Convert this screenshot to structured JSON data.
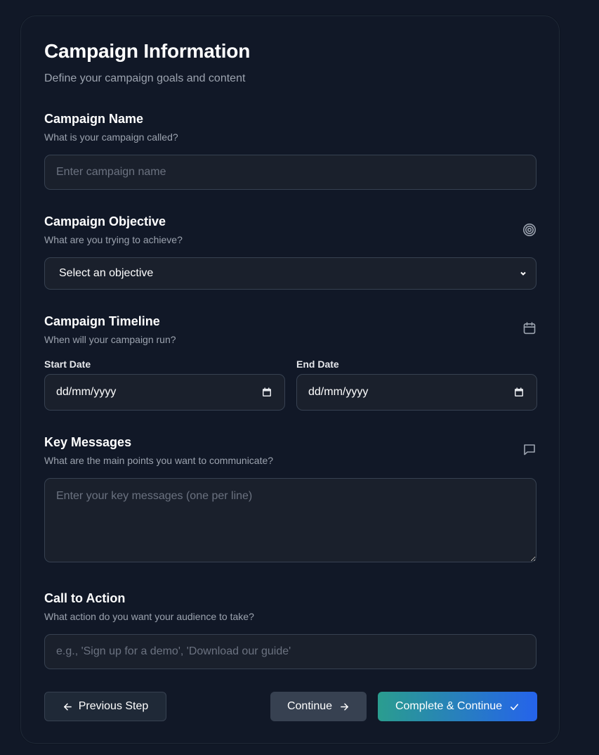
{
  "header": {
    "title": "Campaign Information",
    "subtitle": "Define your campaign goals and content"
  },
  "campaign_name": {
    "title": "Campaign Name",
    "description": "What is your campaign called?",
    "placeholder": "Enter campaign name",
    "value": ""
  },
  "objective": {
    "title": "Campaign Objective",
    "description": "What are you trying to achieve?",
    "icon": "target-icon",
    "selected": "Select an objective"
  },
  "timeline": {
    "title": "Campaign Timeline",
    "description": "When will your campaign run?",
    "icon": "calendar-icon",
    "start_label": "Start Date",
    "start_value": "dd/mm/yyyy",
    "end_label": "End Date",
    "end_value": "dd/mm/yyyy"
  },
  "key_messages": {
    "title": "Key Messages",
    "description": "What are the main points you want to communicate?",
    "icon": "message-icon",
    "placeholder": "Enter your key messages (one per line)",
    "value": ""
  },
  "call_to_action": {
    "title": "Call to Action",
    "description": "What action do you want your audience to take?",
    "placeholder": "e.g., 'Sign up for a demo', 'Download our guide'",
    "value": ""
  },
  "buttons": {
    "previous": "Previous Step",
    "continue": "Continue",
    "complete": "Complete & Continue"
  },
  "colors": {
    "background": "#111827",
    "field_bg": "#1a202c",
    "border": "#374151",
    "accent_start": "#2a9d8f",
    "accent_end": "#2563eb"
  }
}
